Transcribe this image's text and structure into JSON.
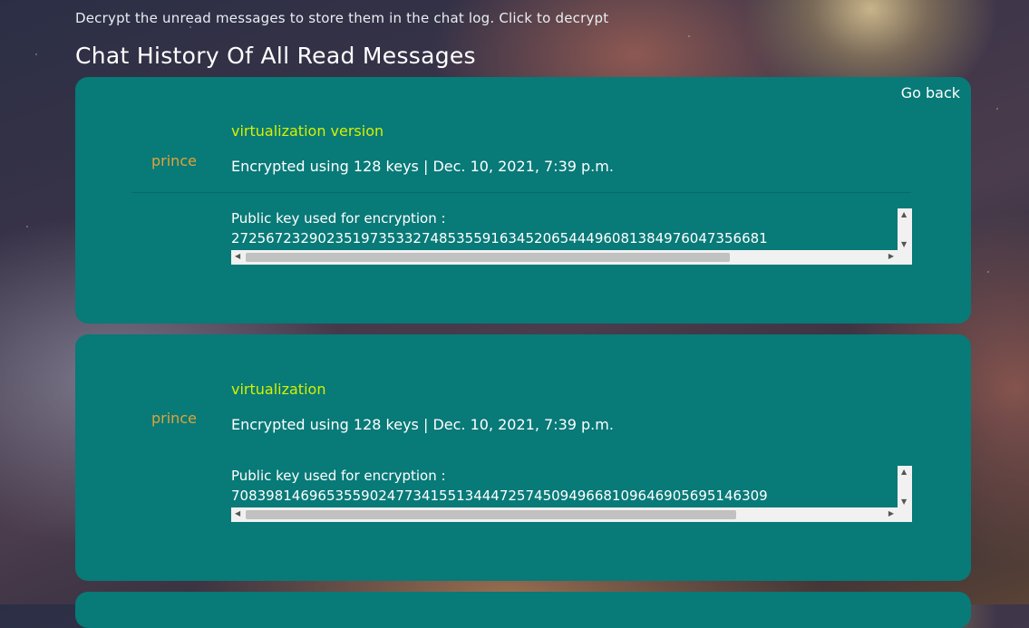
{
  "header": {
    "instruction": "Decrypt the unread messages to store them in the chat log. Click to decrypt",
    "title": "Chat History Of All Read Messages"
  },
  "nav": {
    "go_back": "Go back"
  },
  "messages": [
    {
      "sender": "prince",
      "subject": "virtualization version",
      "meta": "Encrypted using 128 keys | Dec. 10, 2021, 7:39 p.m.",
      "key_label": "Public key used for encryption :",
      "key_value": "27256723290235197353327485355916345206544496081384976047356681",
      "h_scroll_fraction": 0.76
    },
    {
      "sender": "prince",
      "subject": "virtualization",
      "meta": "Encrypted using 128 keys | Dec. 10, 2021, 7:39 p.m.",
      "key_label": "Public key used for encryption :",
      "key_value": "70839814696535590247734155134447257450949668109646905695146309",
      "h_scroll_fraction": 0.77
    }
  ],
  "colors": {
    "card": "#087a78",
    "sender": "#e0a33a",
    "subject": "#d6f000",
    "text": "#ffffff"
  }
}
